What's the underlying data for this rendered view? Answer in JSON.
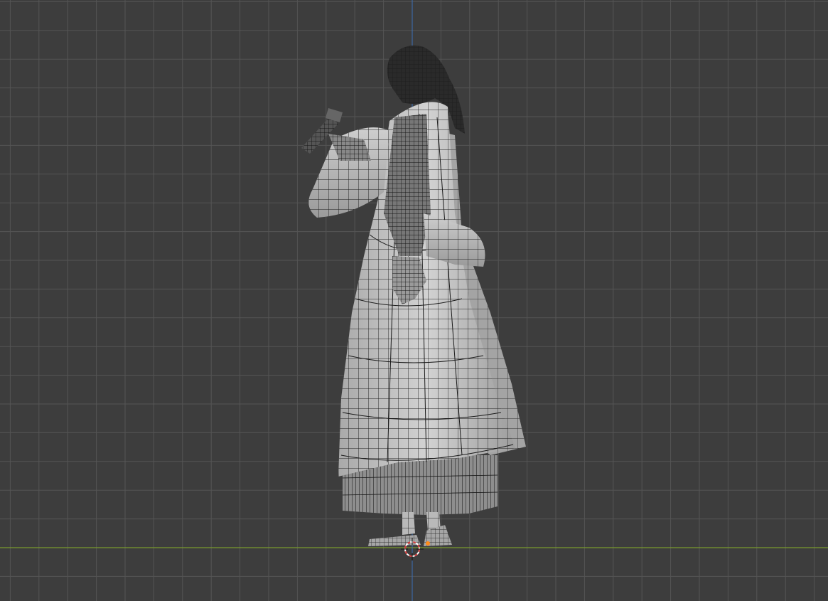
{
  "viewport": {
    "view": "side-orthographic",
    "shading": "wireframe-solid",
    "object": "robed-character-mesh",
    "colors": {
      "background": "#3d3d3d",
      "grid_minor": "#4a4a4a",
      "grid_major": "#555555",
      "x_axis": "#7a9a2e",
      "z_axis": "#3b6fb6",
      "mesh_fill": "#bdbdbd",
      "mesh_wire": "#1e1e1e",
      "cursor_red": "#d43a3a",
      "origin_orange": "#ff8c1a"
    },
    "icons": {
      "cursor": "3d-cursor-icon",
      "origin": "object-origin-icon"
    }
  }
}
